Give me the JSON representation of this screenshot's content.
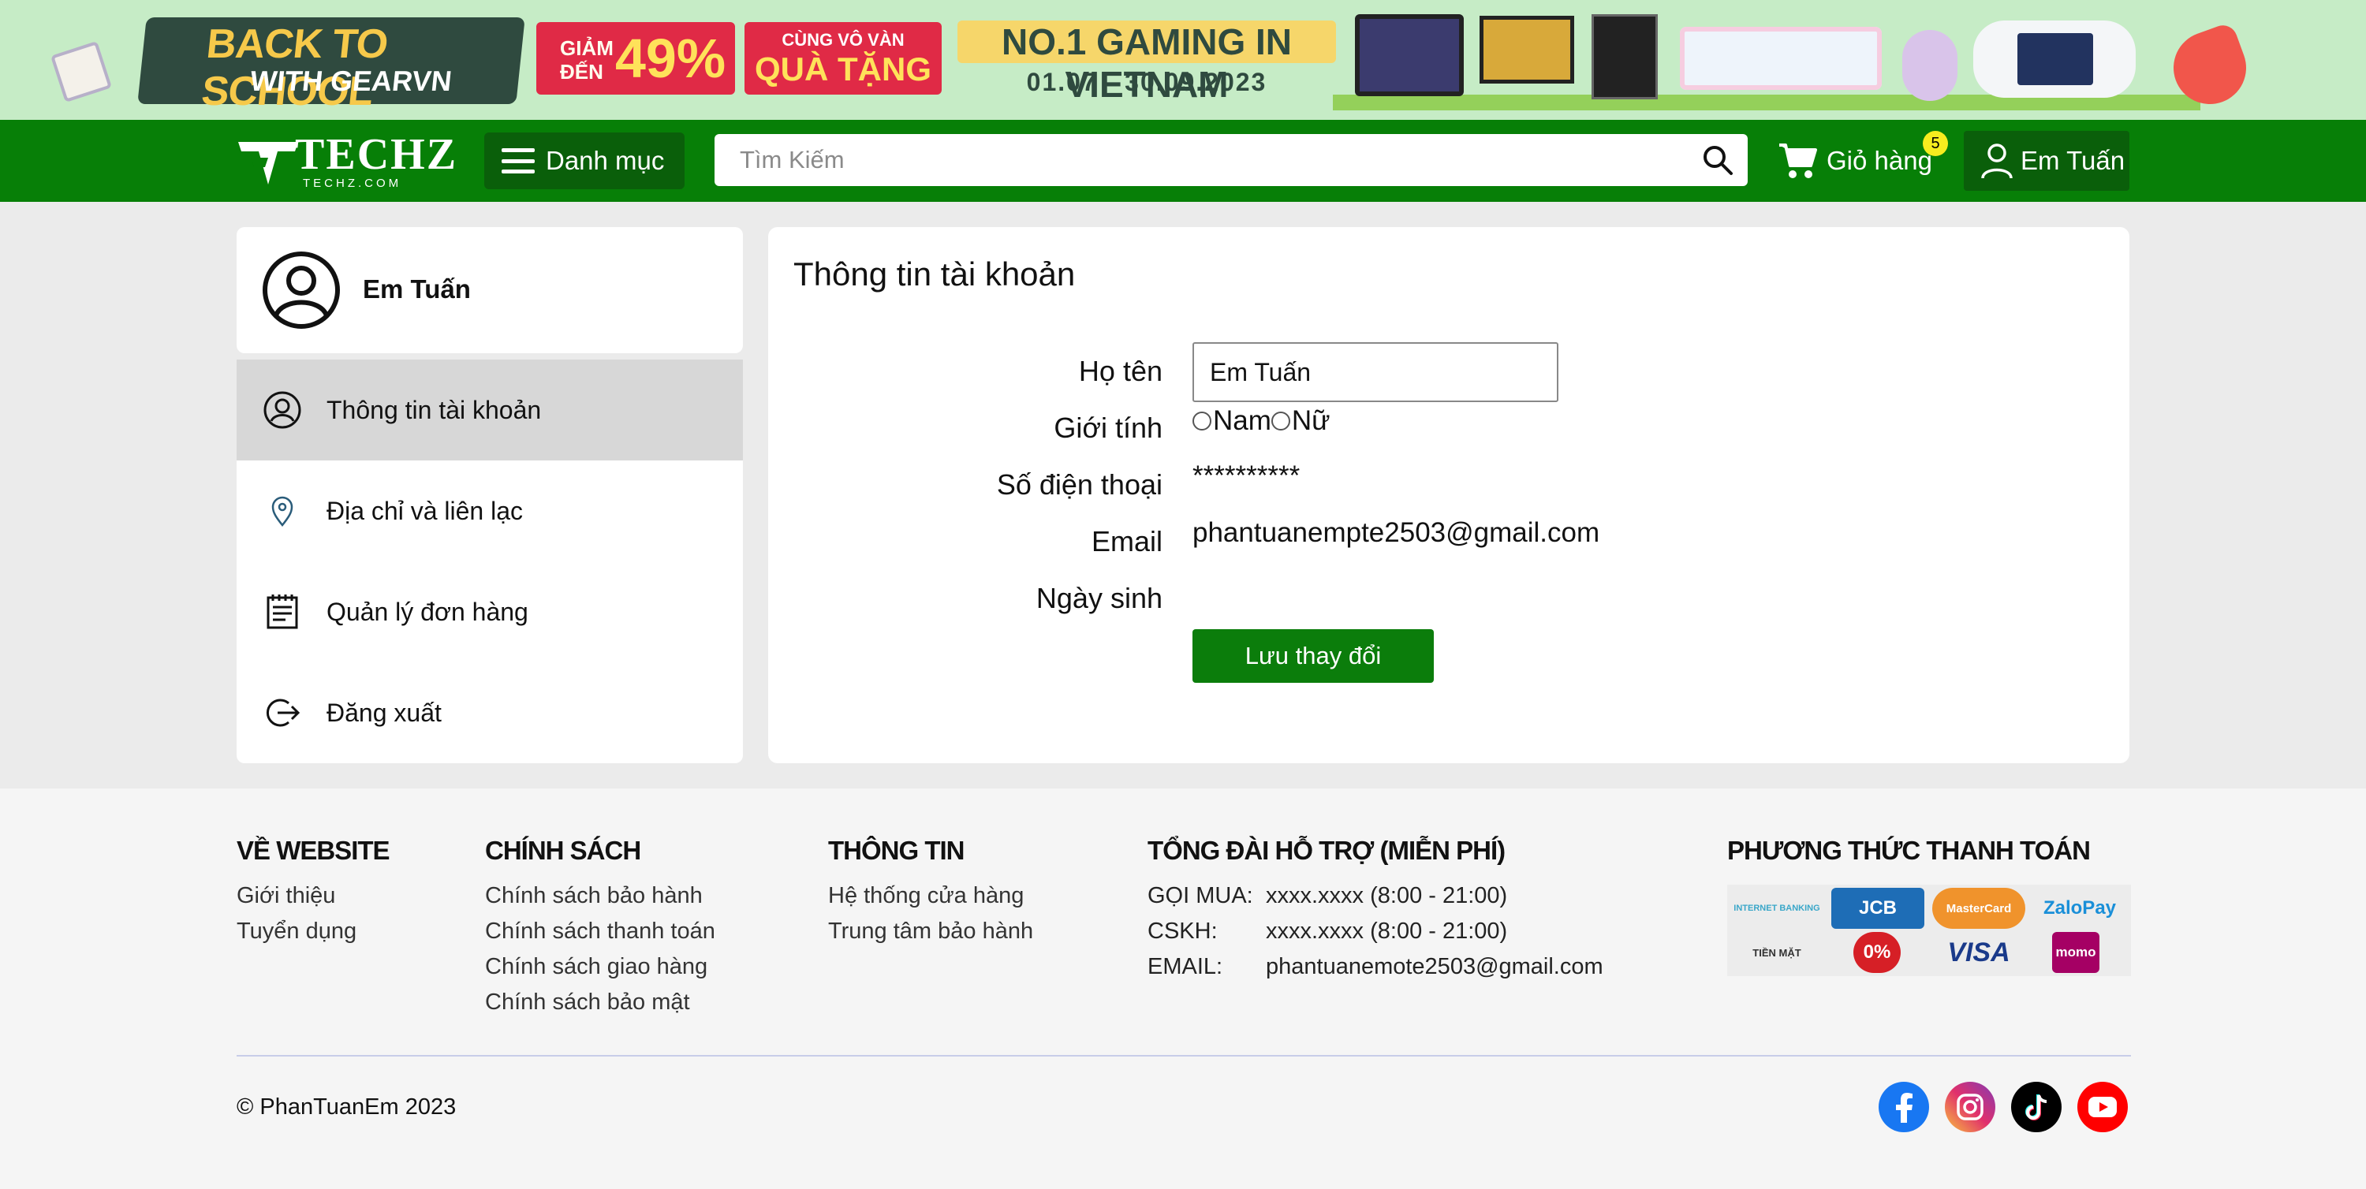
{
  "banner": {
    "title_line1": "BACK TO SCHOOL",
    "title_line2": "WITH GEARVN",
    "discount_prefix": "GIẢM ĐẾN",
    "discount_value": "49%",
    "gift_small": "CÙNG VÔ VÀN",
    "gift_big": "QUÀ TẶNG",
    "gaming": "NO.1 GAMING IN VIETNAM",
    "dates": "01.07 - 30.09.2023"
  },
  "header": {
    "logo_text": "TECHZ",
    "logo_sub": "TECHZ.COM",
    "menu_label": "Danh mục",
    "search_placeholder": "Tìm Kiếm",
    "cart_label": "Giỏ hàng",
    "cart_count": "5",
    "user_label": "Em Tuấn"
  },
  "sidebar": {
    "profile_name": "Em Tuấn",
    "items": [
      {
        "label": "Thông tin tài khoản",
        "icon": "user-circle-icon",
        "active": true
      },
      {
        "label": "Địa chỉ và liên lạc",
        "icon": "location-pin-icon",
        "active": false
      },
      {
        "label": "Quản lý đơn hàng",
        "icon": "order-list-icon",
        "active": false
      },
      {
        "label": "Đăng xuất",
        "icon": "logout-icon",
        "active": false
      }
    ]
  },
  "account": {
    "title": "Thông tin tài khoản",
    "labels": {
      "name": "Họ tên",
      "gender": "Giới tính",
      "phone": "Số điện thoại",
      "email": "Email",
      "birthday": "Ngày sinh"
    },
    "name_value": "Em Tuấn",
    "gender_options": [
      "Nam",
      "Nữ"
    ],
    "phone_value": "**********",
    "email_value": "phantuanempte2503@gmail.com",
    "birthday_value": "",
    "save_label": "Lưu thay đổi"
  },
  "footer": {
    "about": {
      "title": "VỀ WEBSITE",
      "links": [
        "Giới thiệu",
        "Tuyển dụng"
      ]
    },
    "policy": {
      "title": "CHÍNH SÁCH",
      "links": [
        "Chính sách bảo hành",
        "Chính sách thanh toán",
        "Chính sách giao hàng",
        "Chính sách bảo mật"
      ]
    },
    "info": {
      "title": "THÔNG TIN",
      "links": [
        "Hệ thống cửa hàng",
        "Trung tâm bảo hành"
      ]
    },
    "support": {
      "title": "TỔNG ĐÀI HỖ TRỢ (MIỄN PHÍ)",
      "rows": [
        {
          "key": "GỌI MUA:",
          "value": "xxxx.xxxx (8:00 - 21:00)"
        },
        {
          "key": "CSKH:",
          "value": "xxxx.xxxx (8:00 - 21:00)"
        },
        {
          "key": "EMAIL:",
          "value": "phantuanemote2503@gmail.com"
        }
      ]
    },
    "payment": {
      "title": "PHƯƠNG THỨC THANH TOÁN",
      "methods": [
        "INTERNET BANKING",
        "JCB",
        "MasterCard",
        "ZaloPay",
        "TIỀN MẶT",
        "0%",
        "VISA",
        "momo"
      ]
    },
    "copyright": "© PhanTuanEm 2023",
    "social": [
      "facebook-icon",
      "instagram-icon",
      "tiktok-icon",
      "youtube-icon"
    ]
  },
  "colors": {
    "header_green": "#077f07",
    "button_green": "#0b7d0b",
    "banner_bg": "#c6ecc6",
    "active_item": "#d7d7d7",
    "cart_badge": "#f6ec1f"
  }
}
